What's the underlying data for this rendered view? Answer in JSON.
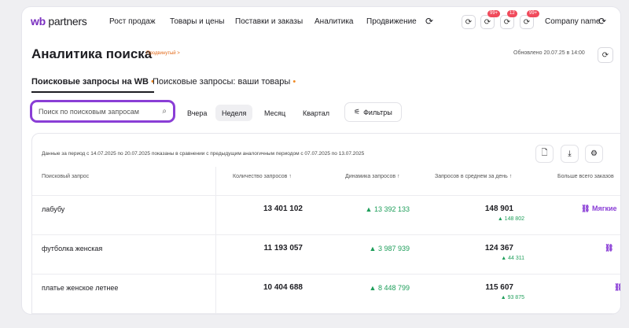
{
  "nav": {
    "logo_wb": "wb",
    "logo_rest": " partners",
    "items": [
      "Рост продаж",
      "Товары и цены",
      "Поставки и заказы",
      "Аналитика",
      "Продвижение"
    ],
    "badges": [
      "99+",
      "12",
      "99+"
    ],
    "company": "Company name"
  },
  "header": {
    "title": "Аналитика поиска",
    "crumb": "Продвинутый >",
    "updated": "Обновлено 20.07.25 в 14:00"
  },
  "tabs": [
    {
      "label": "Поисковые запросы на WB",
      "dot": "•"
    },
    {
      "label": "Поисковые запросы: ваши товары",
      "dot": "•"
    }
  ],
  "search": {
    "placeholder": "Поиск по поисковым запросам"
  },
  "periods": [
    "Вчера",
    "Неделя",
    "Месяц",
    "Квартал"
  ],
  "filters_label": "Фильтры",
  "table": {
    "note": "Данные за период с 14.07.2025 по 20.07.2025 показаны в сравнении с предыдущим аналогичным периодом с 07.07.2025 по 13.07.2025",
    "headers": {
      "query": "Поисковый запрос",
      "count": "Количество запросов ↑",
      "dynamics": "Динамика запросов ↑",
      "avg": "Запросов в среднем за день ↑",
      "more": "Больше всего заказов"
    },
    "rows": [
      {
        "query": "лабубу",
        "count": "13 401 102",
        "dynamics": "▲ 13 392 133",
        "avg": "148 901",
        "avg_delta": "▲ 148 802",
        "more": "Мягкие"
      },
      {
        "query": "футболка женская",
        "count": "11 193 057",
        "dynamics": "▲ 3 987 939",
        "avg": "124 367",
        "avg_delta": "▲ 44 311",
        "more": ""
      },
      {
        "query": "платье женское летнее",
        "count": "10 404 688",
        "dynamics": "▲ 8 448 799",
        "avg": "115 607",
        "avg_delta": "▲ 93 875",
        "more": ""
      }
    ]
  },
  "colors": {
    "accent": "#8a3ed6",
    "positive": "#1e9e5a",
    "badge": "#f04a5b"
  }
}
